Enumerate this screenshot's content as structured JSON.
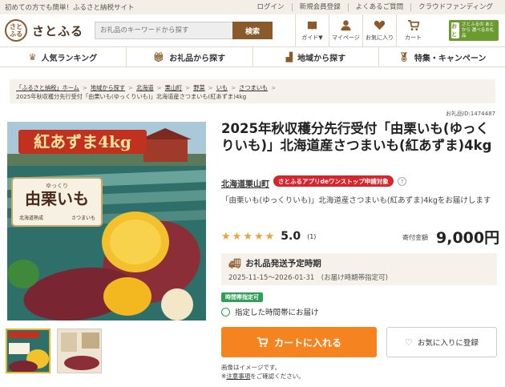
{
  "topbar": {
    "tagline": "初めての方でも簡単！ふるさと納税サイト",
    "links": [
      "ログイン",
      "新規会員登録",
      "よくあるご質問",
      "クラウドファンディング"
    ]
  },
  "header": {
    "logo_mark": "さと ふる",
    "logo_text": "さとふる",
    "search_placeholder": "お礼品のキーワードから探す",
    "search_button": "検索",
    "icons": [
      {
        "label": "ガイド▼",
        "icon": "book-icon"
      },
      {
        "label": "マイページ",
        "icon": "user-icon"
      },
      {
        "label": "お気に入り",
        "icon": "heart-icon"
      },
      {
        "label": "カート",
        "icon": "cart-icon"
      }
    ],
    "satokara_box": "おと",
    "satokara_text": "さとふるの あとから 選べるお礼品"
  },
  "nav": [
    {
      "label": "人気ランキング",
      "icon": "crown-icon"
    },
    {
      "label": "お礼品から探す",
      "icon": "gift-icon"
    },
    {
      "label": "地域から探す",
      "icon": "map-icon"
    },
    {
      "label": "特集・キャンペーン",
      "icon": "medal-icon"
    }
  ],
  "breadcrumb": {
    "items": [
      "「ふるさと納税」ホーム",
      "地域から探す",
      "北海道",
      "栗山町",
      "野菜",
      "いも",
      "さつまいも"
    ],
    "current": "2025年秋収穫分先行受付「由栗いも(ゆっくりいも)」北海道産さつまいも(紅あずま)4kg"
  },
  "product": {
    "item_no": "お礼品ID:1474487",
    "title": "2025年秋収穫分先行受付「由栗いも(ゆっくりいも)」北海道産さつまいも(紅あずま)4kg",
    "municipality": "北海道栗山町",
    "app_badge": "さとふるアプリdeワンストップ申請対象",
    "description": "「由栗いも(ゆっくりいも)」北海道産さつまいも(紅あずま)4kgをお届けします",
    "rating": "5.0",
    "rating_count": "(1)",
    "price_label": "寄付金額",
    "price": "9,000円",
    "image_banner": "紅あずま4kg",
    "image_label_small": "ゆっくり",
    "image_label": "由栗いも",
    "image_sub_left": "北海道熟成",
    "image_sub_right": "さつまいも"
  },
  "shipping": {
    "title": "お礼品発送予定時期",
    "dates": "2025-11-15～2026-01-31　(お届け時期帯指定可)"
  },
  "time": {
    "badge": "時間帯指定可",
    "text": "指定した時間帯にお届け"
  },
  "actions": {
    "cart": "カートに入れる",
    "favorite": "お気に入りに登録"
  },
  "notes": {
    "line1": "画像はイメージです。",
    "line2_prefix": "※",
    "line2_link": "注意事項",
    "line2_suffix": "をご確認ください。"
  },
  "colors": {
    "brand": "#8a5a2b",
    "cart": "#f5831f",
    "badge_red": "#d9242c",
    "green": "#2f9e57"
  }
}
